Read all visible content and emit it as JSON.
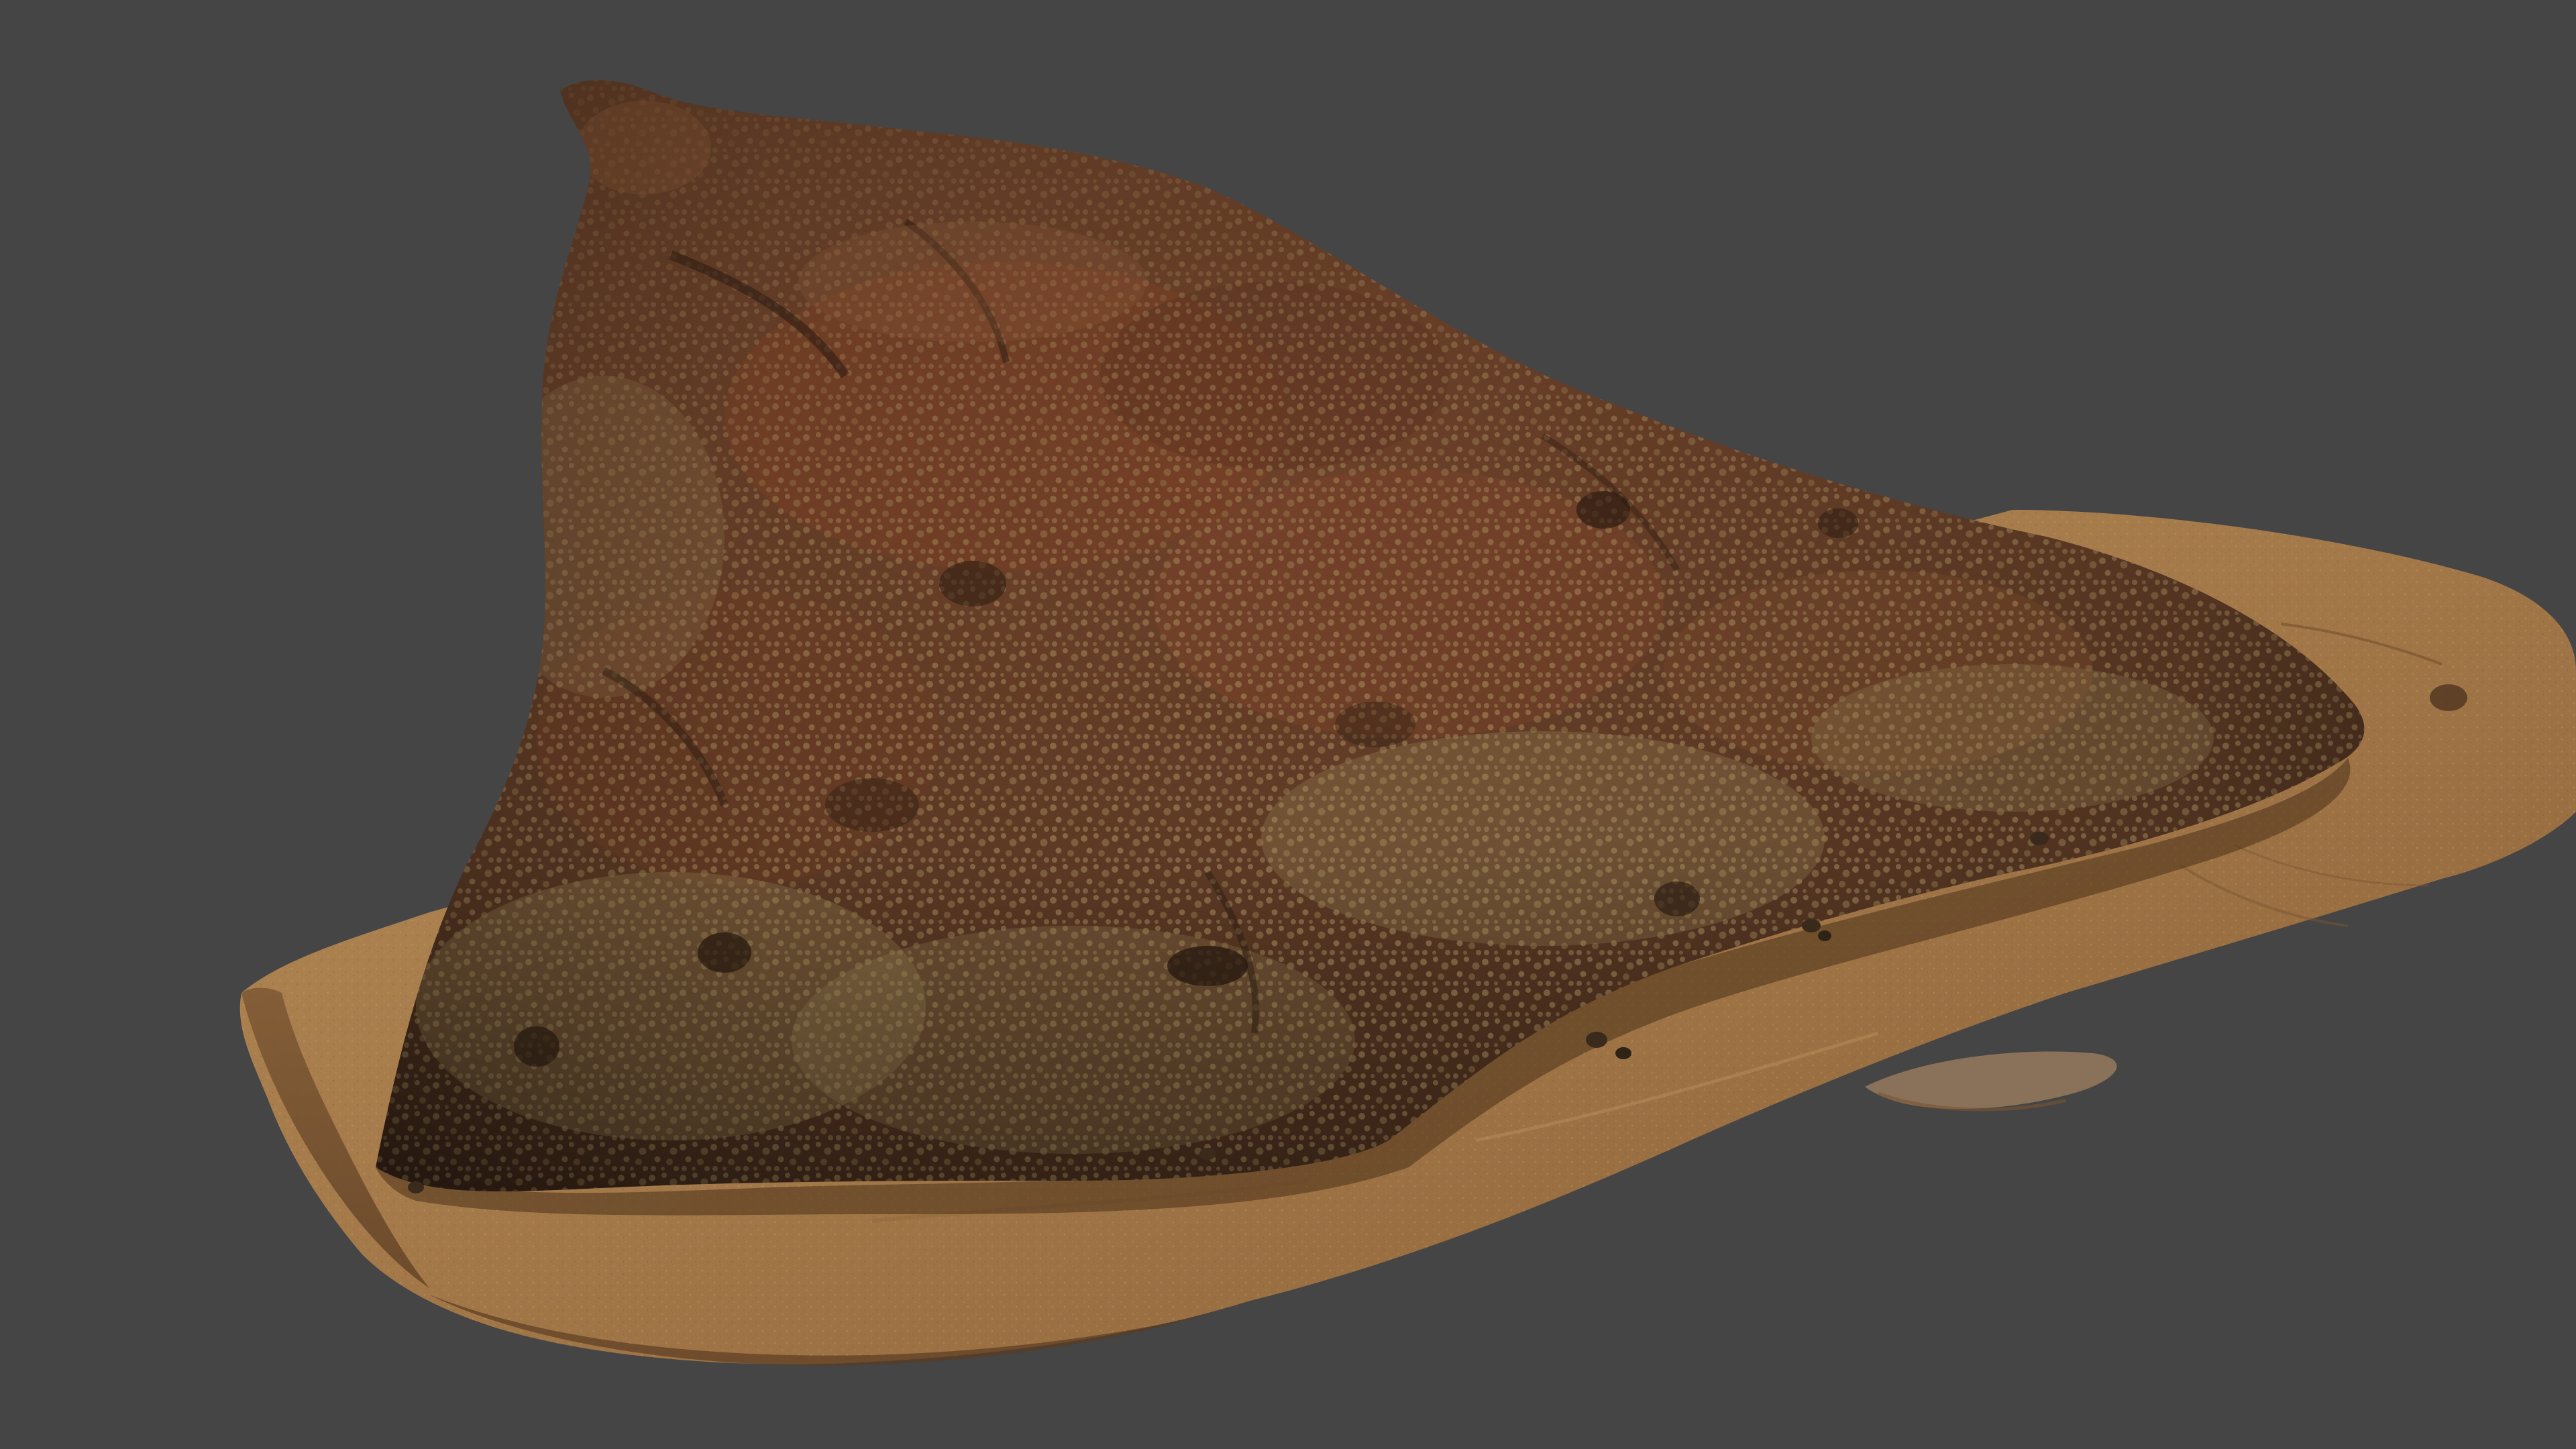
{
  "viewport": {
    "background_color": "#454545",
    "rendered_object": "scanned-rock-on-sand-mesh",
    "colors": {
      "rock_dark": "#4a2e1f",
      "rock_mid": "#6b4028",
      "rock_rust": "#7a3f24",
      "lichen": "#a89060",
      "lichen_light": "#c4ad7a",
      "sand_light": "#b08553",
      "sand_mid": "#9a7044",
      "sand_dark": "#6e4c2c"
    }
  }
}
